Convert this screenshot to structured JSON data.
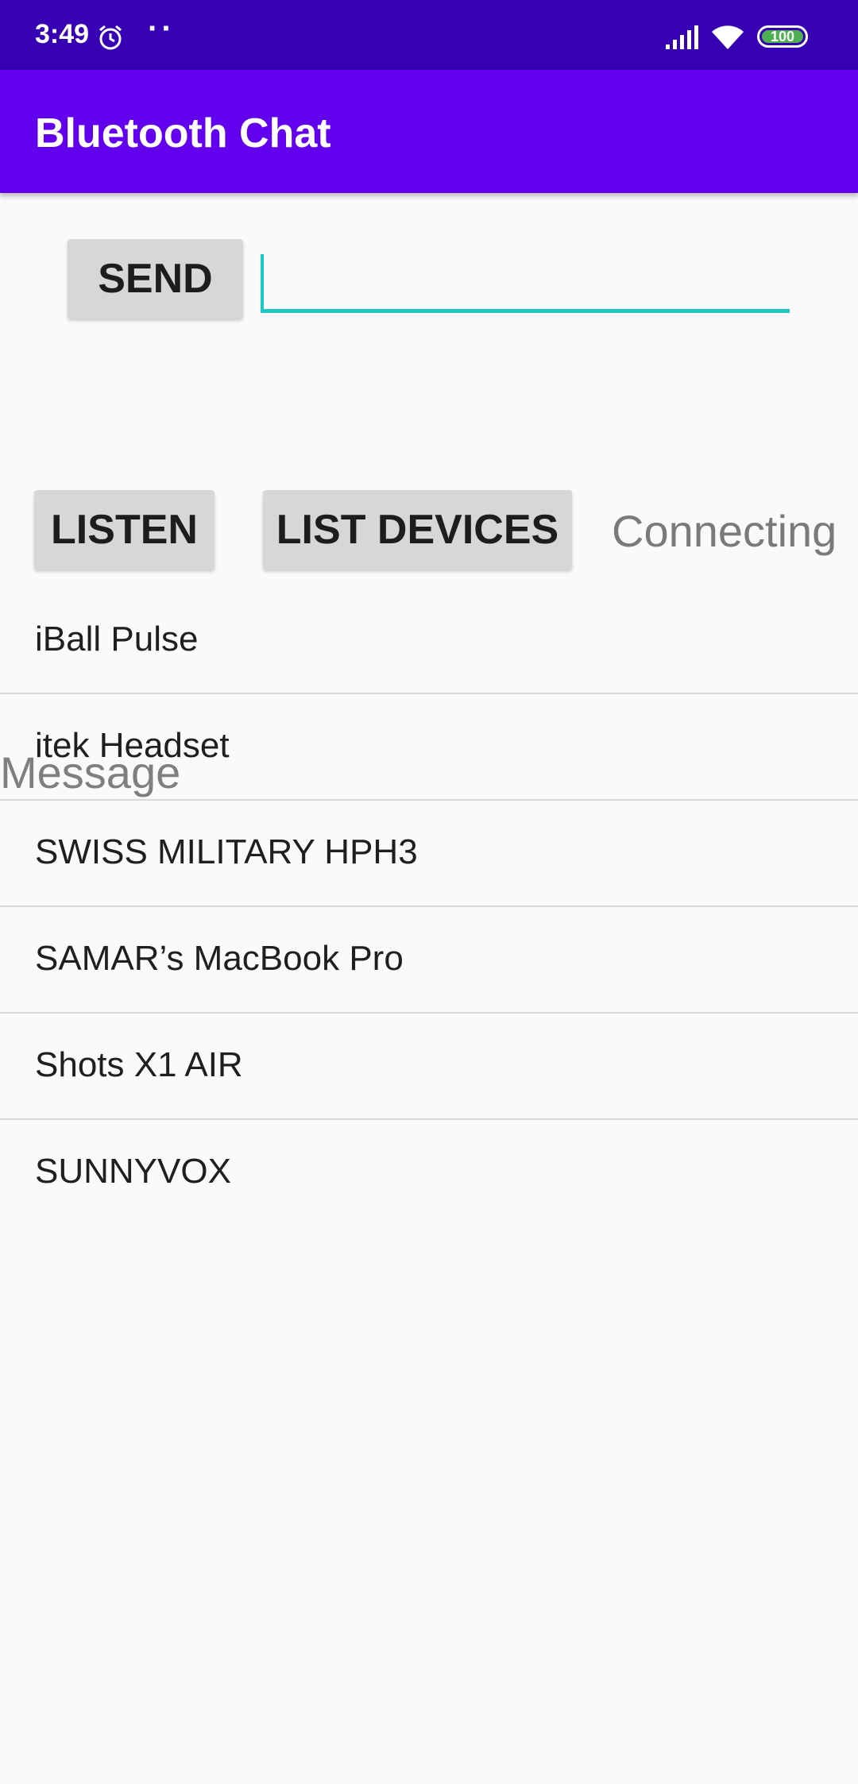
{
  "status_bar": {
    "time": "3:49",
    "dots": "··",
    "battery": "100",
    "icons": [
      "alarm-icon",
      "signal-icon",
      "wifi-icon",
      "battery-icon"
    ]
  },
  "app_bar": {
    "title": "Bluetooth Chat"
  },
  "compose": {
    "send_label": "SEND",
    "input_value": ""
  },
  "controls": {
    "listen_label": "LISTEN",
    "list_devices_label": "LIST DEVICES",
    "status": "Connecting"
  },
  "devices": [
    {
      "name": "iBall Pulse"
    },
    {
      "name": "itek Headset"
    },
    {
      "name": "SWISS MILITARY HPH3"
    },
    {
      "name": "SAMAR’s MacBook Pro"
    },
    {
      "name": "Shots X1 AIR"
    },
    {
      "name": "SUNNYVOX"
    }
  ],
  "message_label": "Message",
  "colors": {
    "status_bar": "#3700b3",
    "app_bar": "#6200ee",
    "input_accent": "#1ec8c0",
    "battery": "#4caf50"
  }
}
